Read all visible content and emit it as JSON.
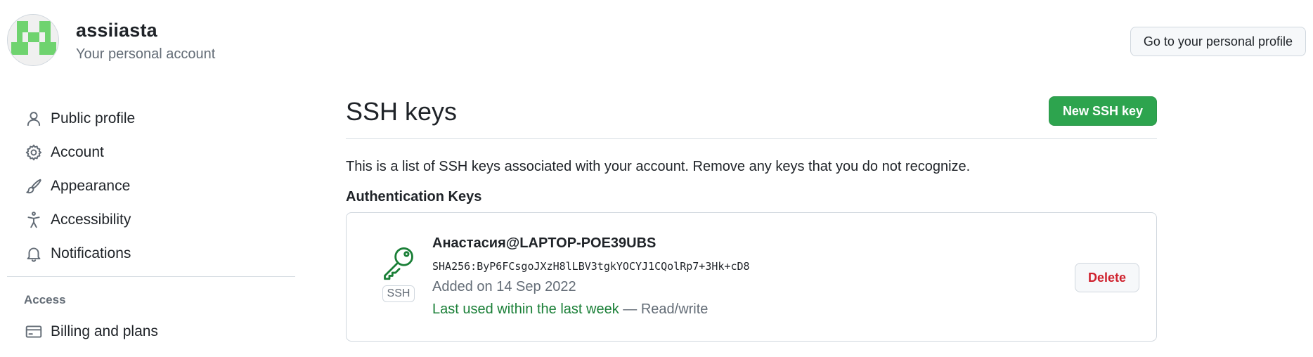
{
  "header": {
    "username": "assiiasta",
    "subtitle": "Your personal account",
    "profile_button": "Go to your personal profile",
    "avatar_color": "#6fd36f"
  },
  "sidebar": {
    "items": [
      {
        "label": "Public profile",
        "icon": "person-icon"
      },
      {
        "label": "Account",
        "icon": "gear-icon"
      },
      {
        "label": "Appearance",
        "icon": "paintbrush-icon"
      },
      {
        "label": "Accessibility",
        "icon": "accessibility-icon"
      },
      {
        "label": "Notifications",
        "icon": "bell-icon"
      }
    ],
    "access_heading": "Access",
    "access_items": [
      {
        "label": "Billing and plans",
        "icon": "credit-card-icon"
      }
    ]
  },
  "main": {
    "title": "SSH keys",
    "new_key_button": "New SSH key",
    "description": "This is a list of SSH keys associated with your account. Remove any keys that you do not recognize.",
    "section_heading": "Authentication Keys",
    "keys": [
      {
        "name": "Анастасия@LAPTOP-POE39UBS",
        "fingerprint": "SHA256:ByP6FCsgoJXzH8lLBV3tgkYOCYJ1CQolRp7+3Hk+cD8",
        "added": "Added on 14 Sep 2022",
        "last_used": "Last used within the last week",
        "access": "— Read/write",
        "badge": "SSH",
        "icon": "key-icon",
        "delete_label": "Delete"
      }
    ]
  },
  "colors": {
    "accent_green": "#2da44e",
    "success_text": "#1a7f37",
    "danger": "#cf222e"
  }
}
